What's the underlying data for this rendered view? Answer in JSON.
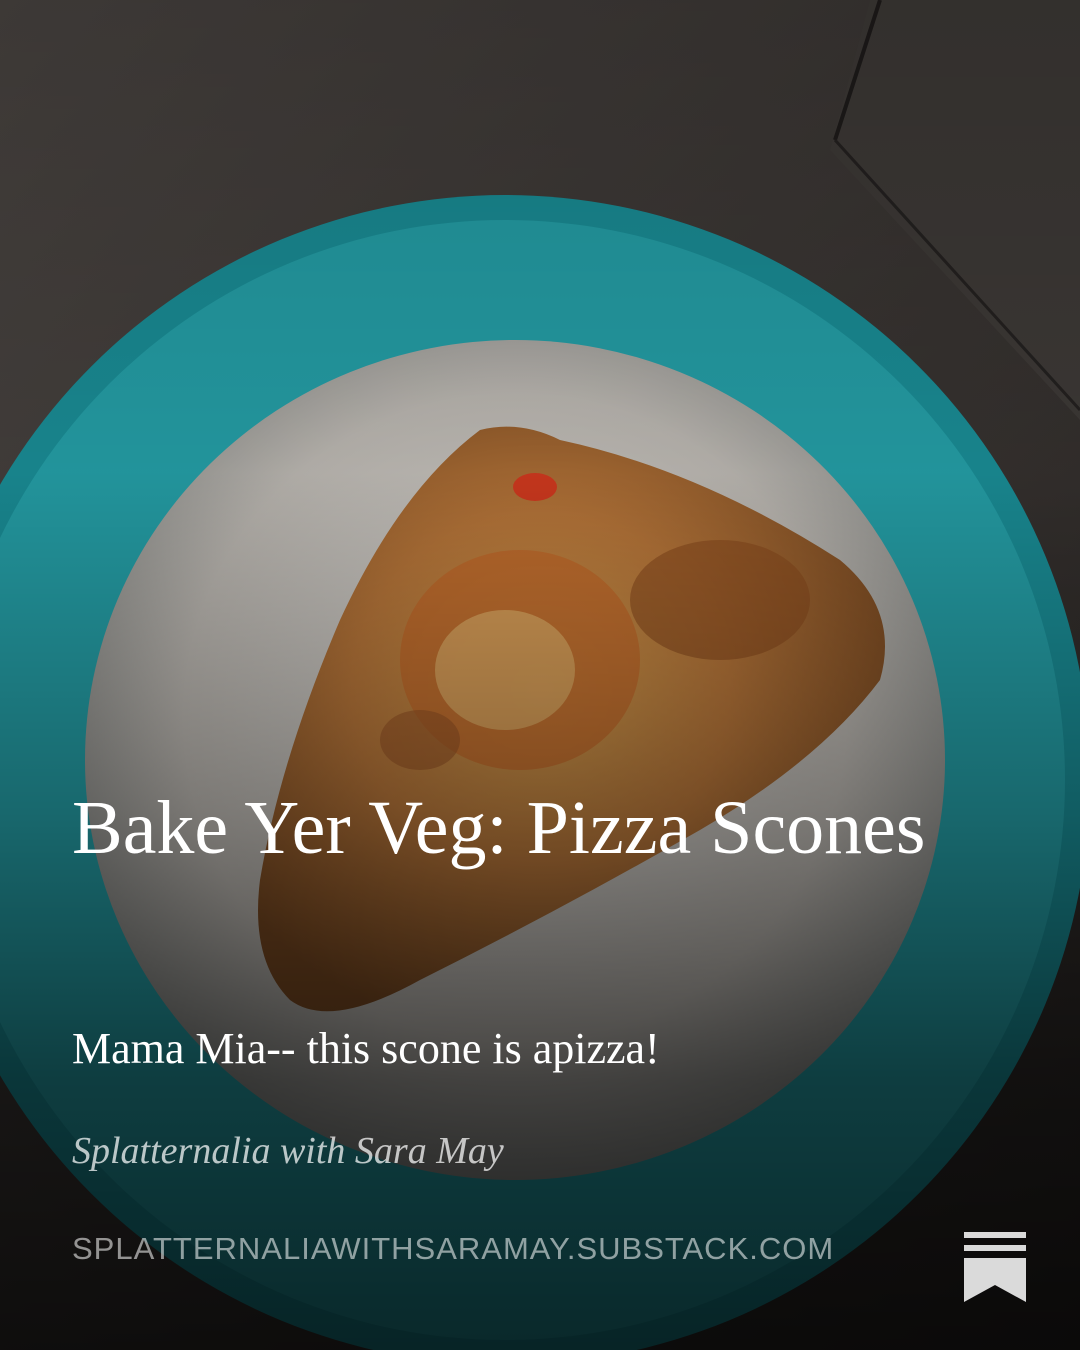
{
  "post": {
    "title": "Bake Yer Veg: Pizza Scones",
    "subtitle": "Mama Mia-- this scone is apizza!",
    "publication": "Splatternalia with Sara May",
    "url": "SPLATTERNALIAWITHSARAMAY.SUBSTACK.COM"
  },
  "logo": {
    "icon": "substack-bookmark-icon",
    "color": "#ffffff"
  },
  "photo": {
    "subject": "pizza-scone-on-teal-plate",
    "plate_color": "#1d8f96",
    "table_color": "#3a3633"
  }
}
